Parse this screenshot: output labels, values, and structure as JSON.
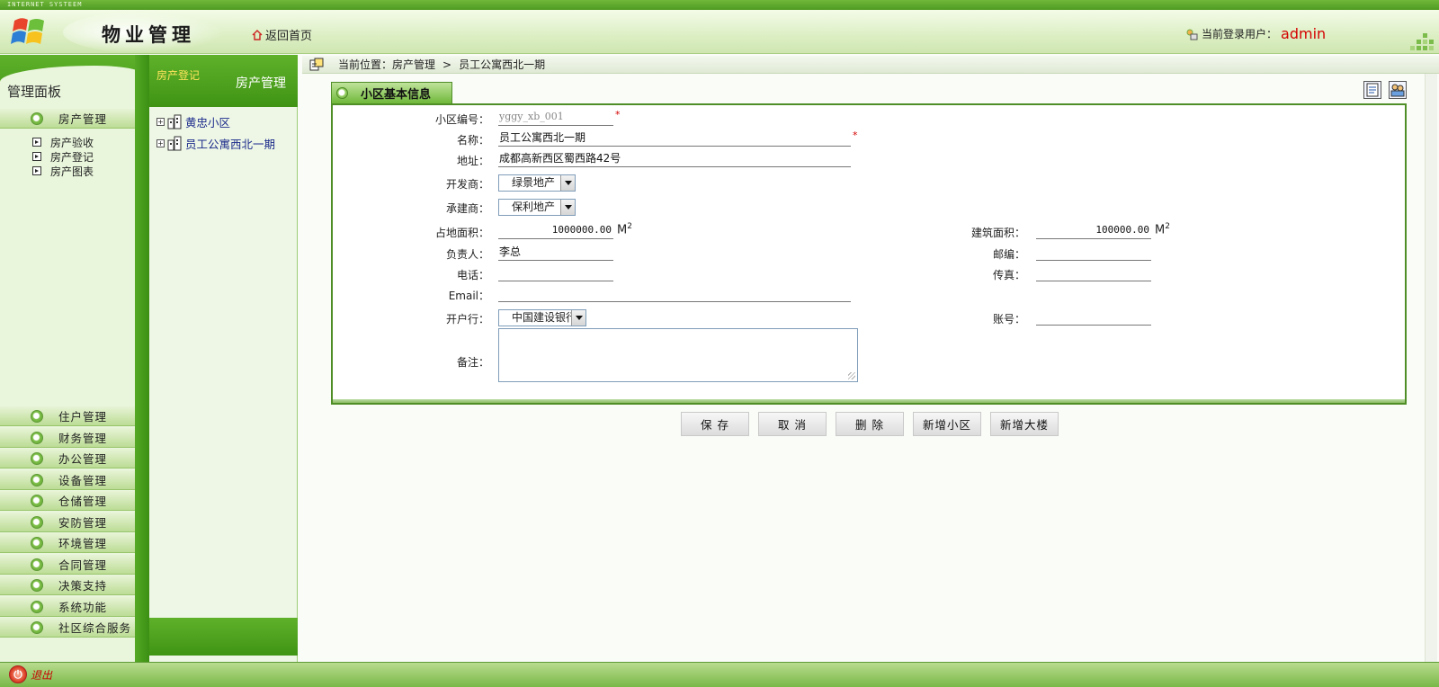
{
  "header": {
    "strip_text": "INTERNET SYSTEEM",
    "app_title": "物业管理",
    "home_link": "返回首页",
    "user_label": "当前登录用户：",
    "username": "admin"
  },
  "left_panel": {
    "title": "管理面板",
    "active_menu": "房产管理",
    "submenu": [
      "房产验收",
      "房产登记",
      "房产图表"
    ],
    "menus": [
      "住户管理",
      "财务管理",
      "办公管理",
      "设备管理",
      "仓储管理",
      "安防管理",
      "环境管理",
      "合同管理",
      "决策支持",
      "系统功能",
      "社区综合服务"
    ]
  },
  "tree_panel": {
    "tab_label": "房产登记",
    "title": "房产管理",
    "nodes": [
      "黄忠小区",
      "员工公寓西北一期"
    ]
  },
  "breadcrumb": {
    "label": "当前位置：房产管理",
    "separator": ">",
    "current": "员工公寓西北一期"
  },
  "panel": {
    "tab_title": "小区基本信息"
  },
  "form": {
    "code_label": "小区编号：",
    "code_value": "yggy_xb_001",
    "name_label": "名称：",
    "name_value": "员工公寓西北一期",
    "address_label": "地址：",
    "address_value": "成都高新西区蜀西路42号",
    "developer_label": "开发商：",
    "developer_value": "绿景地产",
    "builder_label": "承建商：",
    "builder_value": "保利地产",
    "land_area_label": "占地面积：",
    "land_area_value": "1000000.00",
    "build_area_label": "建筑面积：",
    "build_area_value": "100000.00",
    "unit_text": "M",
    "unit_sup": "2",
    "manager_label": "负责人：",
    "manager_value": "李总",
    "postcode_label": "邮编：",
    "postcode_value": "",
    "phone_label": "电话：",
    "phone_value": "",
    "fax_label": "传真：",
    "fax_value": "",
    "email_label": "Email：",
    "email_value": "",
    "bank_label": "开户行：",
    "bank_value": "中国建设银行",
    "account_label": "账号：",
    "account_value": "",
    "remark_label": "备注：",
    "required_mark": "*"
  },
  "actions": [
    "保 存",
    "取 消",
    "删 除",
    "新增小区",
    "新增大楼"
  ],
  "bottom": {
    "exit_label": "退出"
  }
}
